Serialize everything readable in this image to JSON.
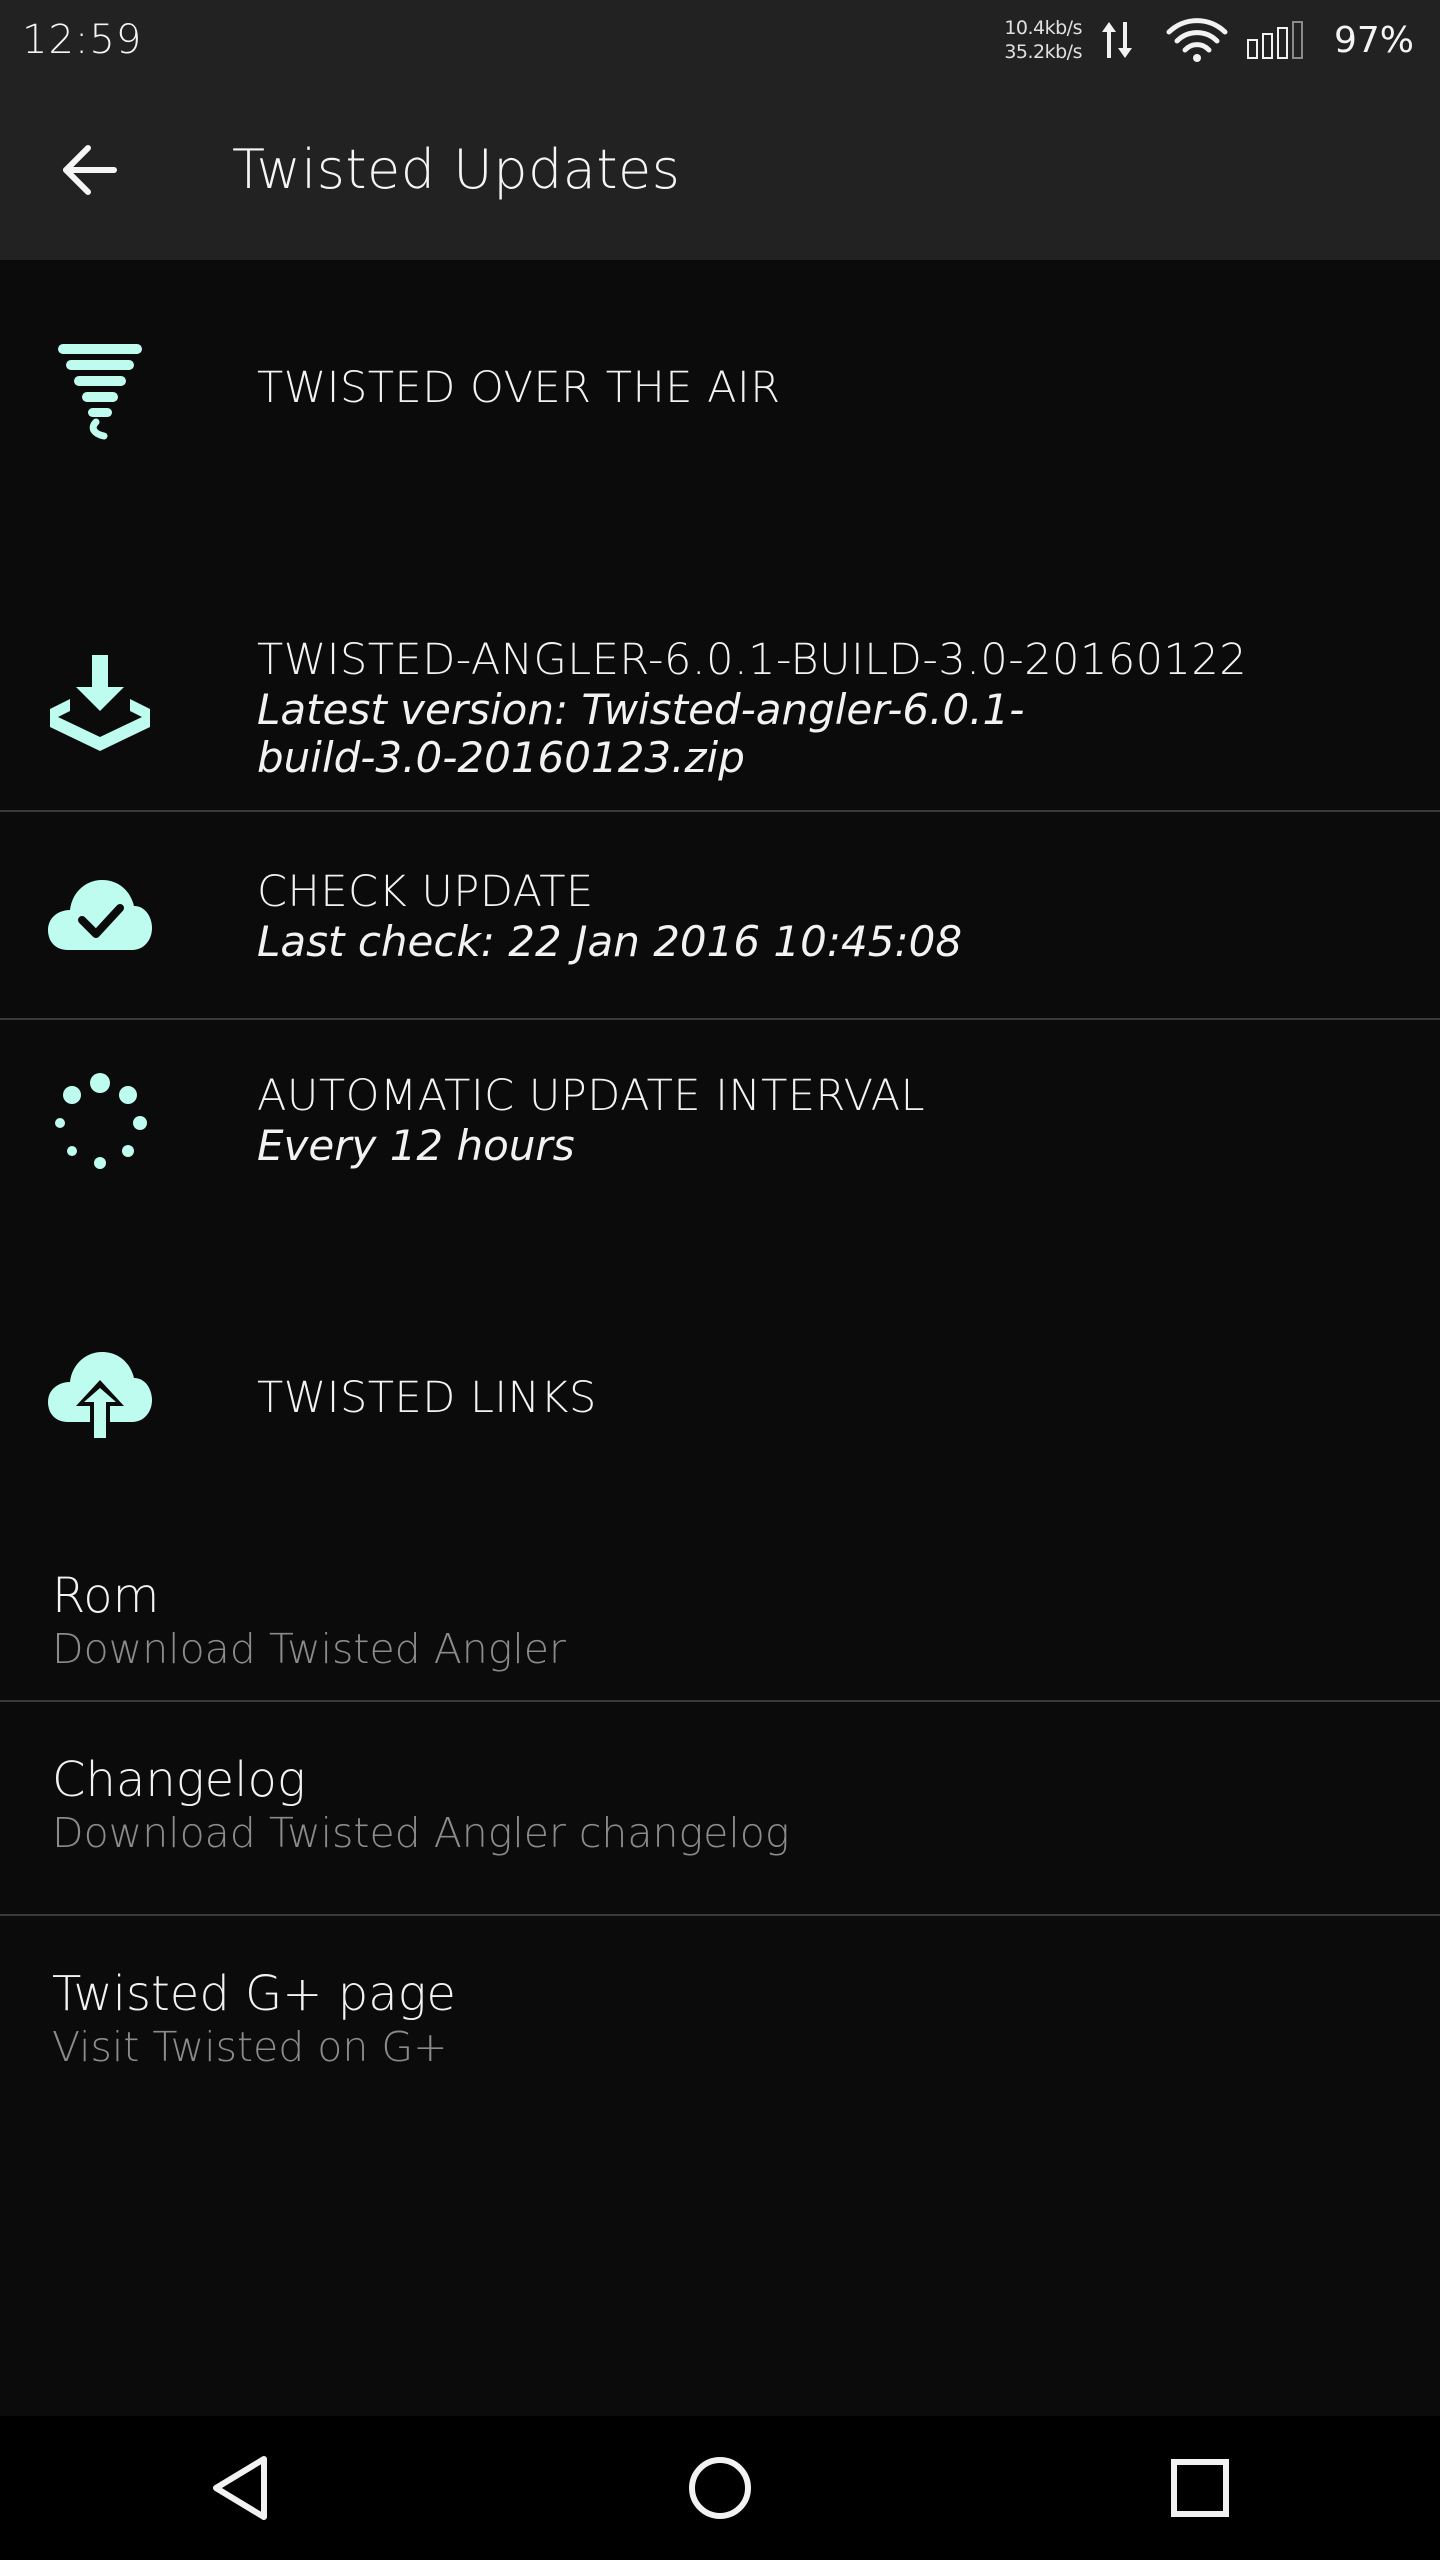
{
  "status_bar": {
    "time": "12:59",
    "up_speed": "10.4kb/s",
    "down_speed": "35.2kb/s",
    "battery": "97%"
  },
  "app_bar": {
    "title": "Twisted Updates"
  },
  "ota": {
    "header": "TWISTED OVER THE AIR",
    "current_build": {
      "title": "TWISTED-ANGLER-6.0.1-BUILD-3.0-20160122",
      "summary_line1": "Latest version: Twisted-angler-6.0.1-",
      "summary_line2": "build-3.0-20160123.zip"
    },
    "check_update": {
      "title": "CHECK UPDATE",
      "summary": "Last check: 22 Jan 2016 10:45:08"
    },
    "interval": {
      "title": "AUTOMATIC UPDATE INTERVAL",
      "summary": "Every 12 hours"
    }
  },
  "links": {
    "header": "TWISTED LINKS",
    "items": [
      {
        "title": "Rom",
        "summary": "Download Twisted Angler"
      },
      {
        "title": "Changelog",
        "summary": "Download Twisted Angler changelog"
      },
      {
        "title": "Twisted G+ page",
        "summary": "Visit Twisted on G+"
      }
    ]
  },
  "colors": {
    "accent": "#bffcf0",
    "background": "#0b0b0b",
    "toolbar": "#222222",
    "divider": "#3a3a3a",
    "summary_gray": "#8b8b8b"
  },
  "icons": {
    "back": "arrow-left-icon",
    "tornado": "tornado-icon",
    "download": "download-tray-icon",
    "cloud_check": "cloud-check-icon",
    "interval": "dotted-spinner-icon",
    "cloud_upload": "cloud-upload-icon"
  }
}
